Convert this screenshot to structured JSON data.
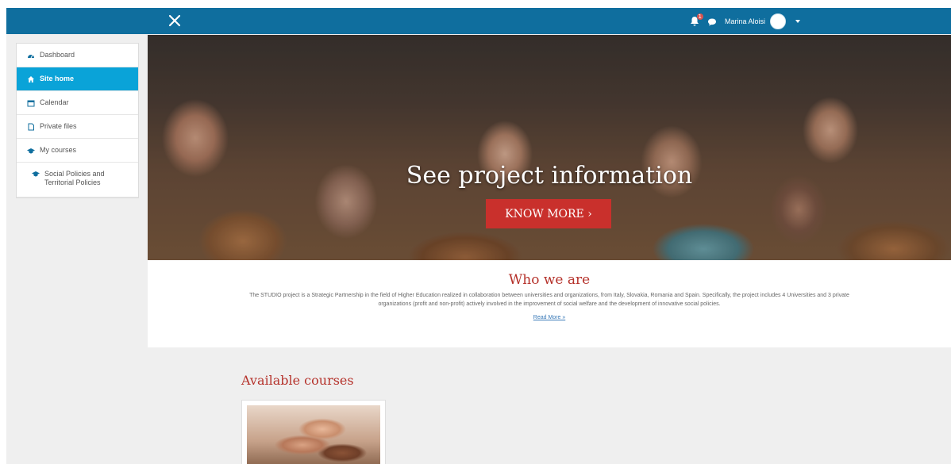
{
  "colors": {
    "navbar": "#0f6e9e",
    "sidebar_active": "#0aa3d8",
    "accent_red": "#c9302c",
    "heading_red": "#b5322b"
  },
  "navbar": {
    "close_icon": "close-icon",
    "notification_count": "1",
    "user_name": "Marina Aloisi"
  },
  "sidebar": {
    "items": [
      {
        "label": "Dashboard",
        "icon": "dashboard-icon"
      },
      {
        "label": "Site home",
        "icon": "home-icon"
      },
      {
        "label": "Calendar",
        "icon": "calendar-icon"
      },
      {
        "label": "Private files",
        "icon": "file-icon"
      },
      {
        "label": "My courses",
        "icon": "graduation-cap-icon"
      },
      {
        "label": "Social Policies and Territorial Policies",
        "icon": "graduation-cap-icon"
      }
    ]
  },
  "hero": {
    "title": "See project information",
    "button_label": "KNOW MORE ›"
  },
  "who": {
    "title": "Who we are",
    "text": "The STUDIO project is a Strategic Partnership in the field of Higher Education realized in collaboration between universities and organizations, from Italy, Slovakia, Romania and Spain. Specifically, the project includes 4 Universities and 3 private organizations (profit and non-profit) actively involved in the improvement of social welfare and the development of innovative social policies.",
    "link": "Read More »"
  },
  "courses": {
    "title": "Available courses"
  }
}
